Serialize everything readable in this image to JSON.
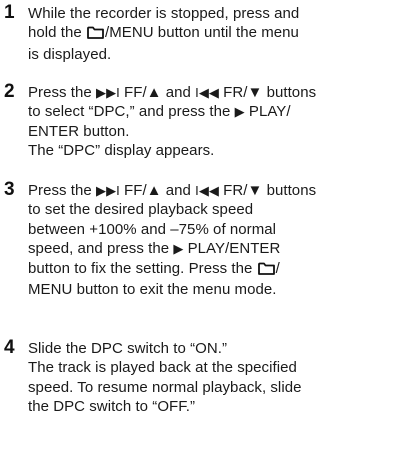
{
  "steps": [
    {
      "number": "1",
      "lines": [
        [
          "While the recorder is stopped, press and"
        ],
        [
          "hold the ",
          {
            "icon": "folder-icon"
          },
          "/MENU button until the menu"
        ],
        [
          "is displayed."
        ]
      ]
    },
    {
      "number": "2",
      "lines": [
        [
          "Press the ",
          {
            "glyph": "▶▶I"
          },
          " FF/▲ and ",
          {
            "glyph": "I◀◀"
          },
          " FR/▼ buttons"
        ],
        [
          "to select “DPC,” and press the ",
          {
            "glyph": "▶"
          },
          " PLAY/"
        ],
        [
          "ENTER button."
        ],
        [
          "The “DPC” display appears."
        ]
      ]
    },
    {
      "number": "3",
      "lines": [
        [
          "Press the ",
          {
            "glyph": "▶▶I"
          },
          " FF/▲ and ",
          {
            "glyph": "I◀◀"
          },
          " FR/▼ buttons"
        ],
        [
          "to set the desired playback speed"
        ],
        [
          "between +100% and –75% of normal"
        ],
        [
          "speed, and press the ",
          {
            "glyph": "▶"
          },
          " PLAY/ENTER"
        ],
        [
          "button to fix the setting. Press the ",
          {
            "icon": "folder-icon"
          },
          "/"
        ],
        [
          "MENU button to exit the menu mode."
        ]
      ]
    },
    {
      "number": "4",
      "lines": [
        [
          "Slide the DPC switch to “ON.”"
        ],
        [
          "The track is played back at the specified"
        ],
        [
          "speed. To resume normal playback, slide"
        ],
        [
          "the DPC switch to “OFF.”"
        ]
      ]
    }
  ]
}
